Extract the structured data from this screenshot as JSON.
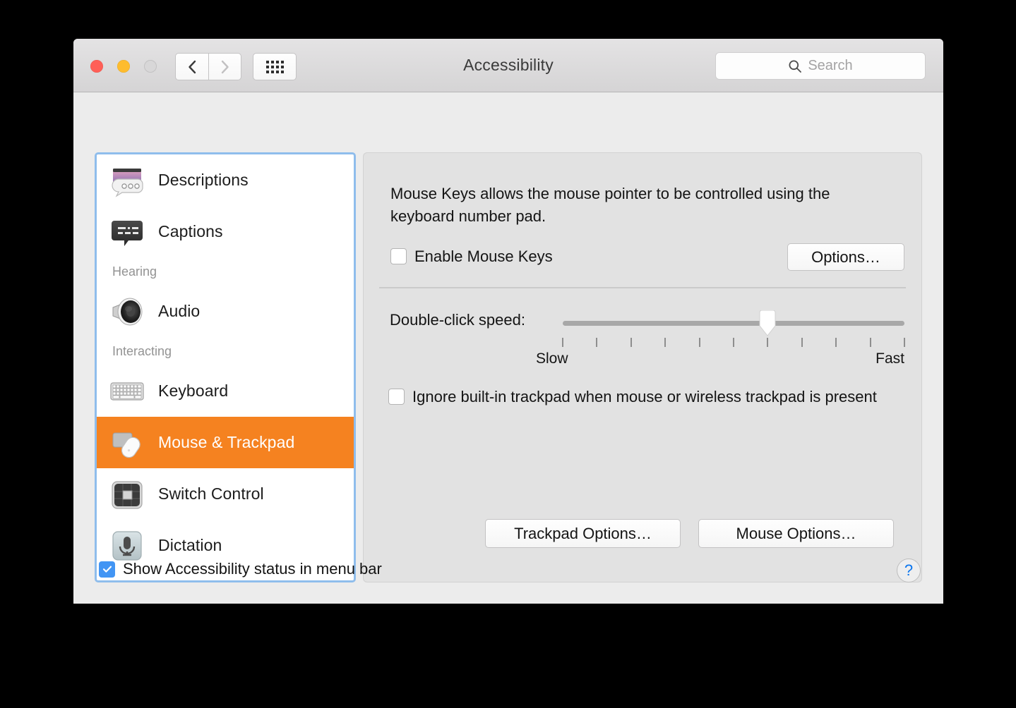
{
  "window": {
    "title": "Accessibility",
    "traffic_lights": [
      "close",
      "minimize",
      "zoom"
    ],
    "nav": {
      "back": "back-chevron",
      "forward": "forward-chevron",
      "grid": "show-all-grid"
    },
    "search": {
      "placeholder": "Search",
      "value": "",
      "icon": "search-icon"
    }
  },
  "sidebar": {
    "items": [
      {
        "type": "item",
        "label": "Descriptions",
        "icon": "descriptions-icon",
        "selected": false
      },
      {
        "type": "item",
        "label": "Captions",
        "icon": "captions-icon",
        "selected": false
      },
      {
        "type": "group",
        "label": "Hearing"
      },
      {
        "type": "item",
        "label": "Audio",
        "icon": "audio-speaker-icon",
        "selected": false
      },
      {
        "type": "group",
        "label": "Interacting"
      },
      {
        "type": "item",
        "label": "Keyboard",
        "icon": "keyboard-icon",
        "selected": false
      },
      {
        "type": "item",
        "label": "Mouse & Trackpad",
        "icon": "mouse-trackpad-icon",
        "selected": true
      },
      {
        "type": "item",
        "label": "Switch Control",
        "icon": "switch-control-icon",
        "selected": false
      },
      {
        "type": "item",
        "label": "Dictation",
        "icon": "dictation-mic-icon",
        "selected": false
      }
    ]
  },
  "main": {
    "description": "Mouse Keys allows the mouse pointer to be controlled using the keyboard number pad.",
    "enable_mouse_keys": {
      "label": "Enable Mouse Keys",
      "checked": false
    },
    "options_button": "Options…",
    "double_click_speed": {
      "label": "Double-click speed:",
      "min_label": "Slow",
      "max_label": "Fast",
      "tick_count": 11,
      "value_index": 6
    },
    "ignore_trackpad": {
      "label": "Ignore built-in trackpad when mouse or wireless trackpad is present",
      "checked": false
    },
    "trackpad_options_button": "Trackpad Options…",
    "mouse_options_button": "Mouse Options…"
  },
  "footer": {
    "show_status": {
      "label": "Show Accessibility status in menu bar",
      "checked": true
    },
    "help_button": "?"
  },
  "colors": {
    "selection_orange": "#f58220",
    "sidebar_focus_ring": "#8fbdec",
    "checkbox_blue": "#4295f4",
    "help_blue": "#0b76ef"
  }
}
